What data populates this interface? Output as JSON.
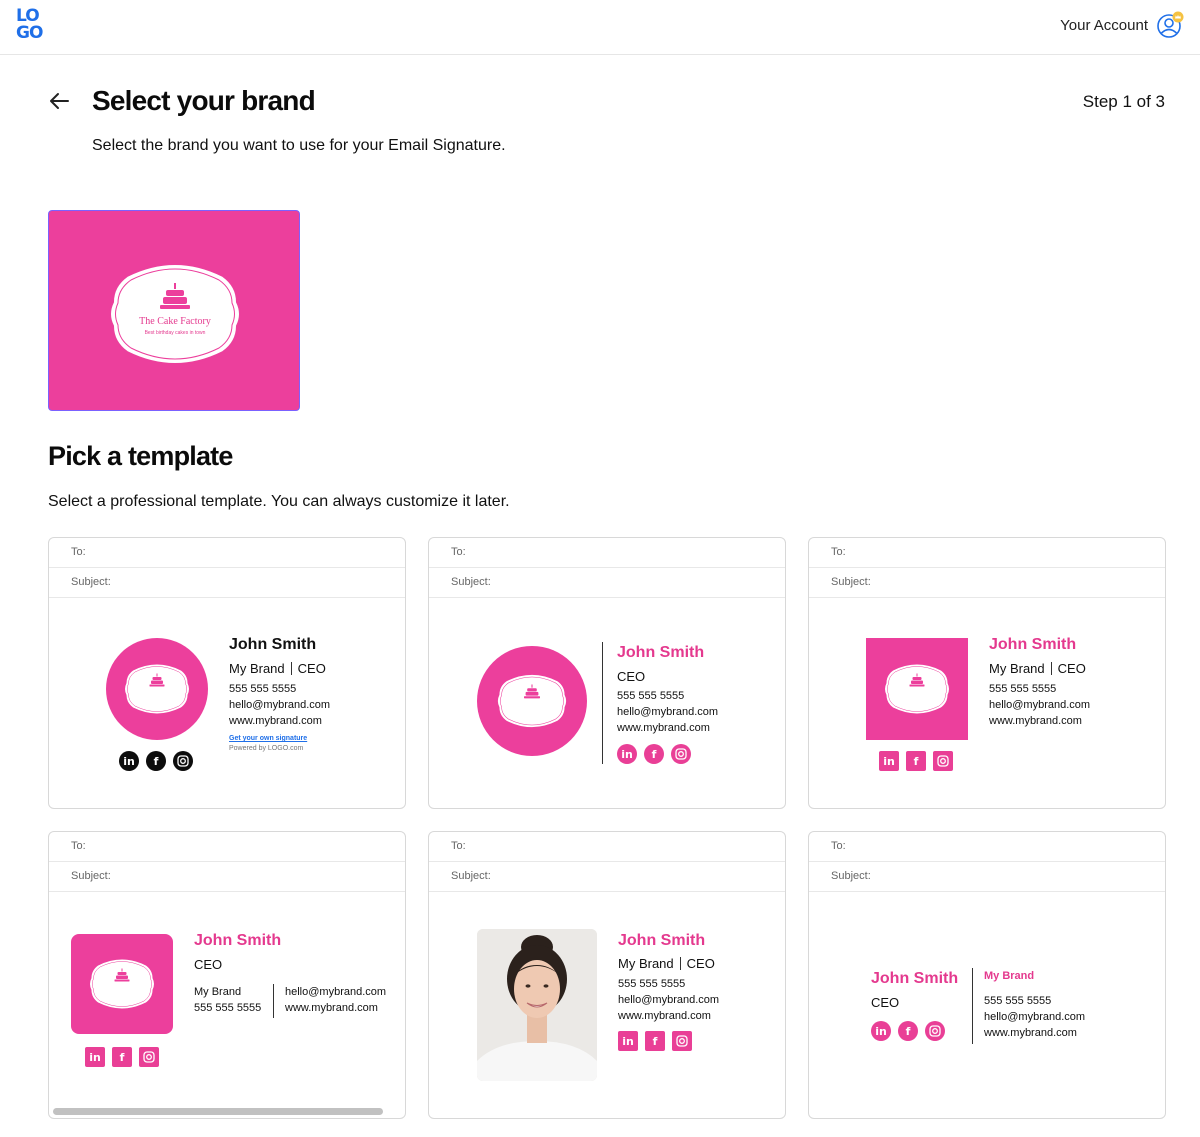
{
  "header": {
    "logo_line1": "LO",
    "logo_line2": "GO",
    "account_label": "Your Account"
  },
  "page": {
    "title": "Select your brand",
    "step": "Step 1 of 3",
    "subtitle": "Select the brand you want to use for your Email Signature."
  },
  "brand": {
    "name": "The Cake Factory",
    "tagline": "Best birthday cakes in town",
    "color": "#ec3f9c"
  },
  "templates_section": {
    "title": "Pick a template",
    "subtitle": "Select a professional template. You can always customize it later."
  },
  "email_fields": {
    "to": "To:",
    "subject": "Subject:"
  },
  "signature": {
    "name": "John Smith",
    "company": "My Brand",
    "role": "CEO",
    "phone": "555 555 5555",
    "email": "hello@mybrand.com",
    "website": "www.mybrand.com",
    "get_own_link": "Get your own signature",
    "powered_by": "Powered by LOGO.com"
  },
  "social_icons": [
    "linkedin-icon",
    "facebook-icon",
    "instagram-icon"
  ],
  "social_glyphs": {
    "linkedin": "in",
    "facebook": "f"
  },
  "colors": {
    "accent": "#ec3f9c",
    "name_pink": "#e4398e",
    "selection": "#7b61ff",
    "logo_blue": "#1f6fe8"
  }
}
